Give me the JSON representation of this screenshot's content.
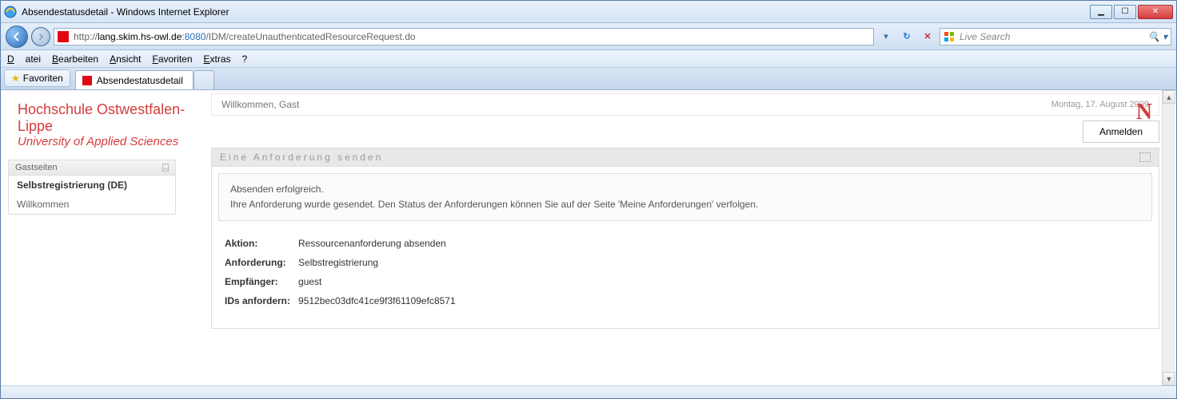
{
  "window": {
    "title": "Absendestatusdetail - Windows Internet Explorer"
  },
  "address": {
    "protocol": "http://",
    "host": "lang.skim.hs-owl.de",
    "port": ":8080",
    "path": "/IDM/createUnauthenticatedResourceRequest.do"
  },
  "search": {
    "placeholder": "Live Search"
  },
  "menubar": {
    "file": "Datei",
    "edit": "Bearbeiten",
    "view": "Ansicht",
    "favorites": "Favoriten",
    "extras": "Extras",
    "help": "?"
  },
  "tabbar": {
    "favorites_button": "Favoriten",
    "tab_title": "Absendestatusdetail"
  },
  "org": {
    "name": "Hochschule Ostwestfalen-Lippe",
    "sub": "University of Applied Sciences"
  },
  "sidebar": {
    "group": "Gastseiten",
    "items": [
      {
        "label": "Selbstregistrierung (DE)",
        "active": true
      },
      {
        "label": "Willkommen",
        "active": false
      }
    ]
  },
  "header": {
    "welcome": "Willkommen, Gast",
    "date": "Montag, 17. August 2009",
    "login": "Anmelden",
    "brand": "N"
  },
  "panel": {
    "title": "Eine Anforderung senden",
    "msg1": "Absenden erfolgreich.",
    "msg2": "Ihre Anforderung wurde gesendet. Den Status der Anforderungen können Sie auf der Seite 'Meine Anforderungen' verfolgen.",
    "rows": [
      {
        "k": "Aktion:",
        "v": "Ressourcenanforderung absenden"
      },
      {
        "k": "Anforderung:",
        "v": "Selbstregistrierung"
      },
      {
        "k": "Empfänger:",
        "v": "guest"
      },
      {
        "k": "IDs anfordern:",
        "v": "9512bec03dfc41ce9f3f61109efc8571"
      }
    ]
  }
}
